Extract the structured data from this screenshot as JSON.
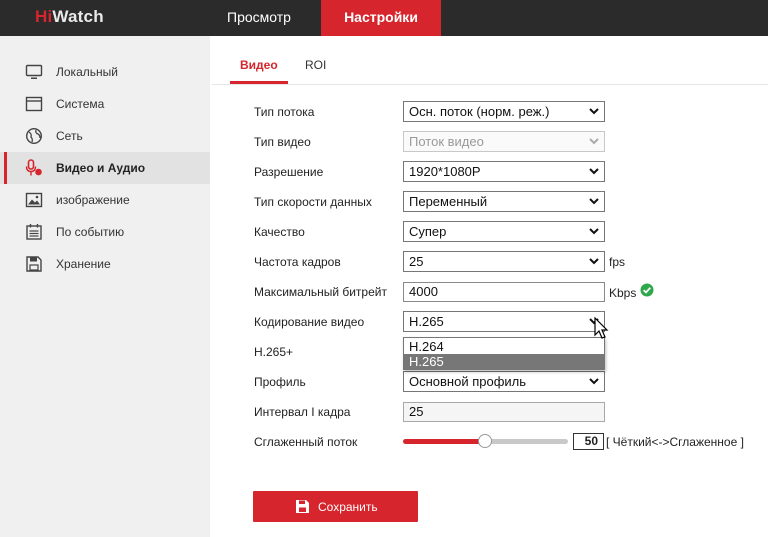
{
  "header": {
    "logo_hi": "Hi",
    "logo_watch": "Watch",
    "tabs": [
      {
        "label": "Просмотр"
      },
      {
        "label": "Настройки"
      }
    ]
  },
  "sidebar": {
    "items": [
      {
        "label": "Локальный",
        "icon": "monitor-icon"
      },
      {
        "label": "Система",
        "icon": "window-icon"
      },
      {
        "label": "Сеть",
        "icon": "globe-icon"
      },
      {
        "label": "Видео и Аудио",
        "icon": "microphone-icon",
        "active": true
      },
      {
        "label": "изображение",
        "icon": "image-icon"
      },
      {
        "label": "По событию",
        "icon": "calendar-icon"
      },
      {
        "label": "Хранение",
        "icon": "save-disk-icon"
      }
    ]
  },
  "subtabs": {
    "video": "Видео",
    "roi": "ROI"
  },
  "form": {
    "stream_type": {
      "label": "Тип потока",
      "value": "Осн. поток (норм. реж.)"
    },
    "video_type": {
      "label": "Тип видео",
      "value": "Поток видео"
    },
    "resolution": {
      "label": "Разрешение",
      "value": "1920*1080P"
    },
    "bitrate_type": {
      "label": "Тип скорости данных",
      "value": "Переменный"
    },
    "quality": {
      "label": "Качество",
      "value": "Супер"
    },
    "frame_rate": {
      "label": "Частота кадров",
      "value": "25",
      "unit": "fps"
    },
    "max_bitrate": {
      "label": "Максимальный битрейт",
      "value": "4000",
      "unit": "Kbps"
    },
    "encoding": {
      "label": "Кодирование видео",
      "value": "H.265",
      "options": [
        "H.264",
        "H.265"
      ],
      "selected_option": "H.265"
    },
    "h265plus": {
      "label": "H.265+"
    },
    "profile": {
      "label": "Профиль",
      "value": "Основной профиль"
    },
    "iframe_interval": {
      "label": "Интервал I кадра",
      "value": "25"
    },
    "smoothing": {
      "label": "Сглаженный поток",
      "value": "50",
      "range_label": "[ Чёткий<->Сглаженное ]",
      "min": 1,
      "max": 100
    }
  },
  "save_button": {
    "label": "Сохранить"
  },
  "colors": {
    "accent": "#d6252c",
    "topbar": "#2b2b2b",
    "sidebar": "#f0f0f0",
    "ok": "#2ea84a"
  }
}
